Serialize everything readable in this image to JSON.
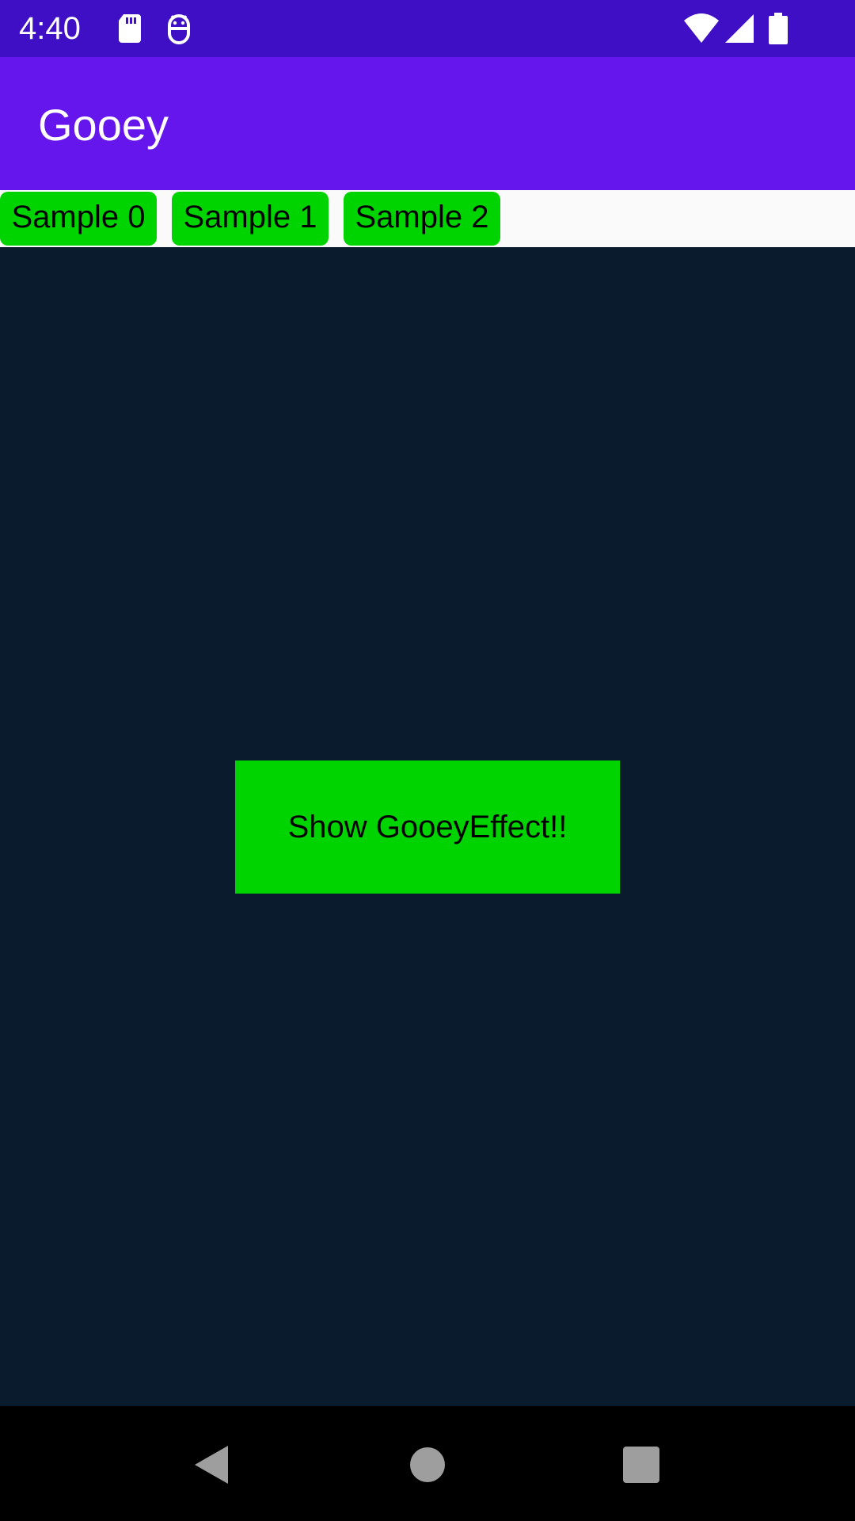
{
  "status_bar": {
    "time": "4:40",
    "icons": [
      "sd-card-icon",
      "android-debug-icon",
      "wifi-icon",
      "signal-icon",
      "battery-icon"
    ]
  },
  "app_bar": {
    "title": "Gooey"
  },
  "tabs": [
    {
      "label": "Sample 0"
    },
    {
      "label": "Sample 1"
    },
    {
      "label": "Sample 2"
    }
  ],
  "main": {
    "action_label": "Show GooeyEffect!!"
  },
  "nav_bar": {
    "buttons": [
      "back-icon",
      "home-icon",
      "recents-icon"
    ]
  },
  "colors": {
    "status_bar": "#3e0fc4",
    "app_bar": "#6516ec",
    "tab_strip": "#fafafa",
    "accent_green": "#00d400",
    "content_bg": "#0a1b2e",
    "nav_bar": "#000000"
  }
}
